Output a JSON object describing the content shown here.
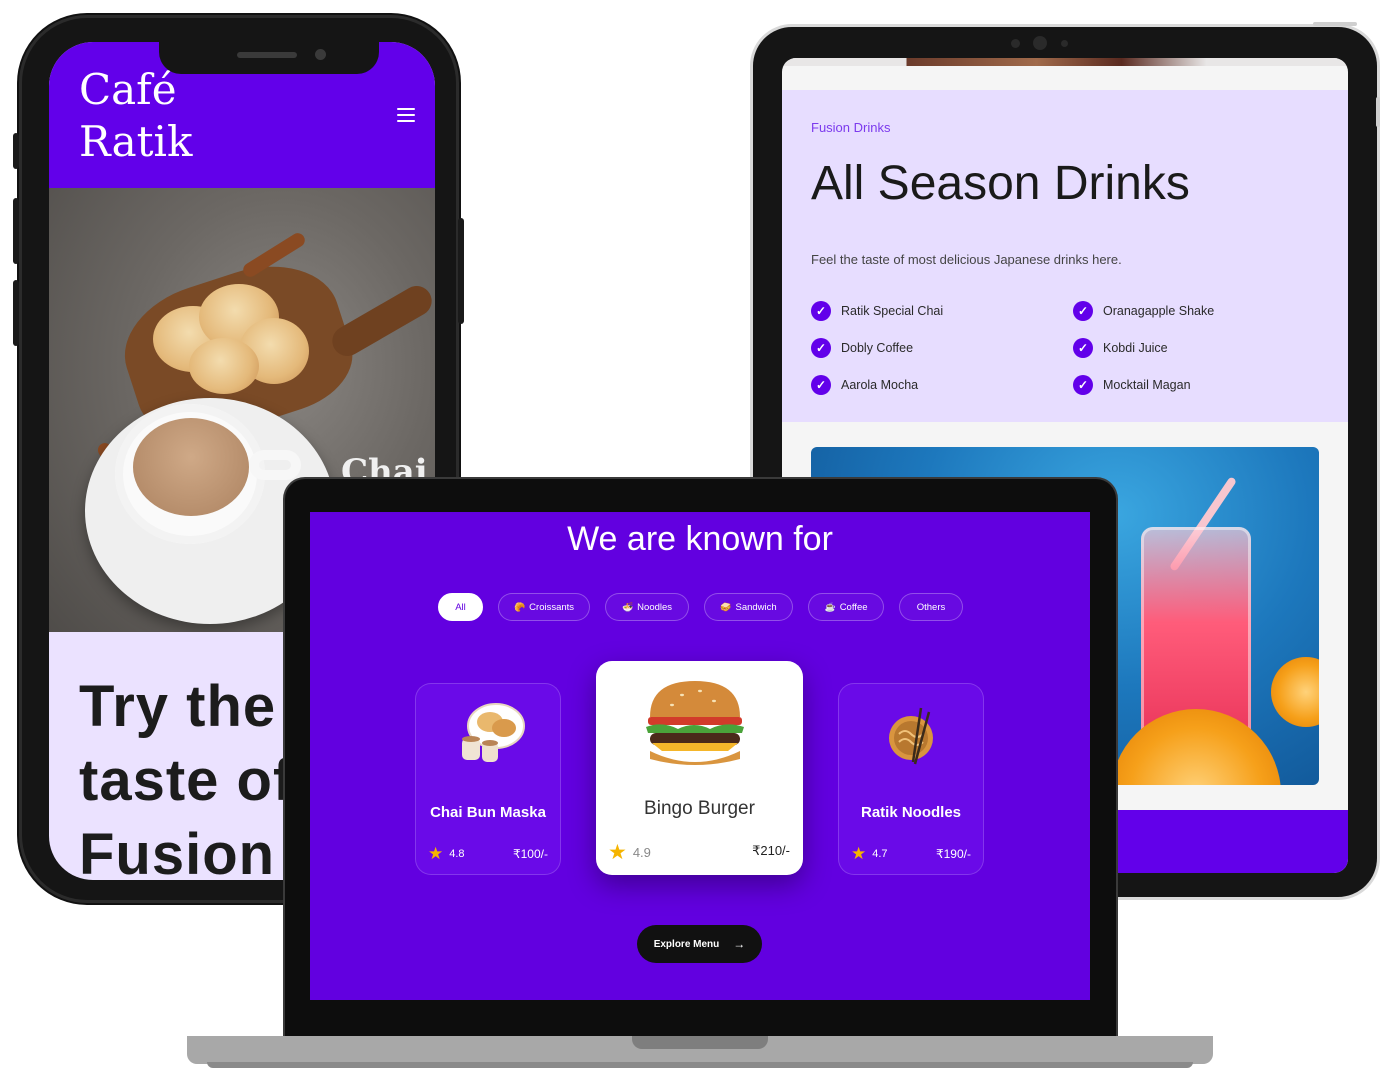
{
  "phone": {
    "logo_line1": "Café",
    "logo_line2": "Ratik",
    "hero_overlay_text": "Chai",
    "heading_line1": "Try the",
    "heading_line2": "taste of",
    "heading_line3": "Fusion f"
  },
  "tablet": {
    "kicker": "Fusion Drinks",
    "title": "All Season Drinks",
    "description": "Feel the taste of most delicious Japanese drinks here.",
    "drinks_left": [
      "Ratik Special Chai",
      "Dobly Coffee",
      "Aarola Mocha"
    ],
    "drinks_right": [
      "Oranagapple Shake",
      "Kobdi Juice",
      "Mocktail Magan"
    ]
  },
  "laptop": {
    "title": "We are known for",
    "tabs": [
      {
        "label": "All",
        "icon": ""
      },
      {
        "label": "Croissants",
        "icon": "🥐"
      },
      {
        "label": "Noodles",
        "icon": "🍜"
      },
      {
        "label": "Sandwich",
        "icon": "🥪"
      },
      {
        "label": "Coffee",
        "icon": "☕"
      },
      {
        "label": "Others",
        "icon": ""
      }
    ],
    "cards": [
      {
        "name": "Chai Bun Maska",
        "rating": "4.8",
        "price": "₹100/-"
      },
      {
        "name": "Bingo Burger",
        "rating": "4.9",
        "price": "₹210/-"
      },
      {
        "name": "Ratik Noodles",
        "rating": "4.7",
        "price": "₹190/-"
      }
    ],
    "explore_label": "Explore Menu",
    "explore_icon": "arrow-right-icon"
  },
  "colors": {
    "brand_purple": "#6200ea",
    "lavender": "#e7ddff",
    "star": "#f5b400"
  }
}
